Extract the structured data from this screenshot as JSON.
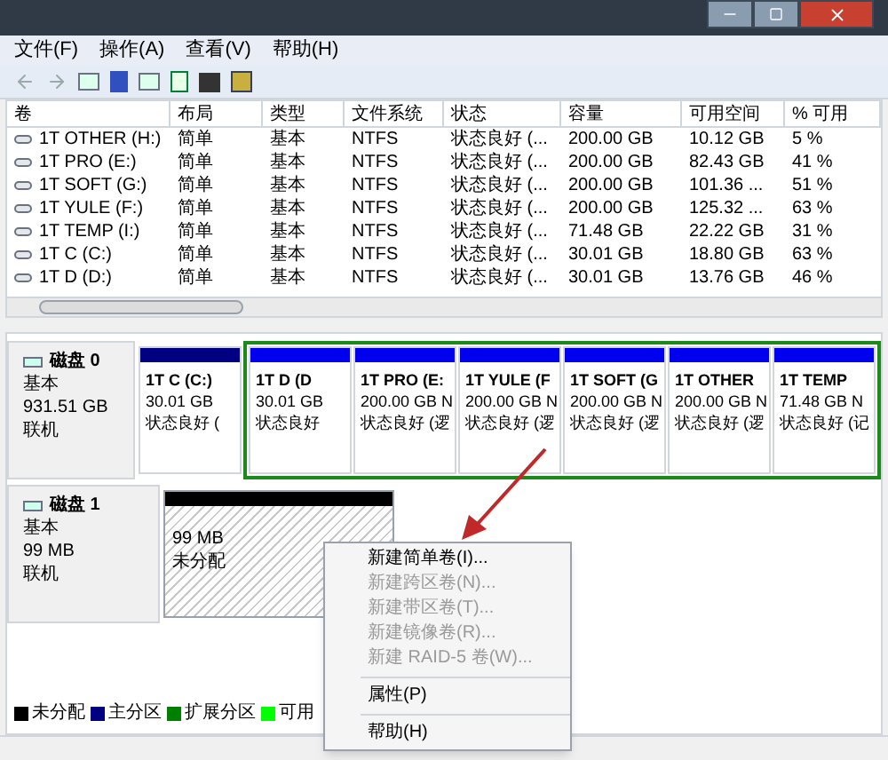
{
  "menu_bar": [
    "文件(F)",
    "操作(A)",
    "查看(V)",
    "帮助(H)"
  ],
  "table": {
    "columns": [
      "卷",
      "布局",
      "类型",
      "文件系统",
      "状态",
      "容量",
      "可用空间",
      "% 可用"
    ],
    "rows": [
      {
        "cells": [
          "1T OTHER (H:)",
          "简单",
          "基本",
          "NTFS",
          "状态良好 (...",
          "200.00 GB",
          "10.12 GB",
          "5 %"
        ]
      },
      {
        "cells": [
          "1T PRO (E:)",
          "简单",
          "基本",
          "NTFS",
          "状态良好 (...",
          "200.00 GB",
          "82.43 GB",
          "41 %"
        ]
      },
      {
        "cells": [
          "1T SOFT (G:)",
          "简单",
          "基本",
          "NTFS",
          "状态良好 (...",
          "200.00 GB",
          "101.36 ...",
          "51 %"
        ]
      },
      {
        "cells": [
          "1T YULE (F:)",
          "简单",
          "基本",
          "NTFS",
          "状态良好 (...",
          "200.00 GB",
          "125.32 ...",
          "63 %"
        ]
      },
      {
        "cells": [
          "1T TEMP (I:)",
          "简单",
          "基本",
          "NTFS",
          "状态良好 (...",
          "71.48 GB",
          "22.22 GB",
          "31 %"
        ]
      },
      {
        "cells": [
          "1T C (C:)",
          "简单",
          "基本",
          "NTFS",
          "状态良好 (...",
          "30.01 GB",
          "18.80 GB",
          "63 %"
        ]
      },
      {
        "cells": [
          "1T D (D:)",
          "简单",
          "基本",
          "NTFS",
          "状态良好 (...",
          "30.01 GB",
          "13.76 GB",
          "46 %"
        ]
      }
    ]
  },
  "disks": [
    {
      "name": "磁盘 0",
      "type": "基本",
      "size": "931.51 GB",
      "status": "联机",
      "partitions": [
        {
          "kind": "primary",
          "selected": false,
          "name": "1T C  (C:)",
          "size": "30.01 GB",
          "status": "状态良好 ("
        },
        {
          "kind": "logical",
          "selected": true,
          "name": "1T D  (D",
          "size": "30.01 GB",
          "status": "状态良好"
        },
        {
          "kind": "logical",
          "selected": true,
          "name": "1T PRO  (E:",
          "size": "200.00 GB N",
          "status": "状态良好 (逻"
        },
        {
          "kind": "logical",
          "selected": true,
          "name": "1T YULE  (F",
          "size": "200.00 GB N",
          "status": "状态良好 (逻"
        },
        {
          "kind": "logical",
          "selected": true,
          "name": "1T SOFT  (G",
          "size": "200.00 GB N",
          "status": "状态良好 (逻"
        },
        {
          "kind": "logical",
          "selected": true,
          "name": "1T OTHER",
          "size": "200.00 GB N",
          "status": "状态良好 (逻"
        },
        {
          "kind": "logical",
          "selected": true,
          "name": "1T TEMP",
          "size": "71.48 GB N",
          "status": "状态良好 (记"
        }
      ]
    },
    {
      "name": "磁盘 1",
      "type": "基本",
      "size": "99 MB",
      "status": "联机",
      "partitions": [
        {
          "kind": "unallocated",
          "selected": false,
          "size": "99 MB",
          "status": "未分配"
        }
      ]
    }
  ],
  "legend": [
    {
      "label": "未分配",
      "color": "#000000"
    },
    {
      "label": "主分区",
      "color": "#000080"
    },
    {
      "label": "扩展分区",
      "color": "#008000"
    },
    {
      "label": "可用",
      "color": "#00ff00"
    }
  ],
  "context_menu": [
    {
      "kind": "item",
      "label": "新建简单卷(I)...",
      "disabled": false
    },
    {
      "kind": "item",
      "label": "新建跨区卷(N)...",
      "disabled": true
    },
    {
      "kind": "item",
      "label": "新建带区卷(T)...",
      "disabled": true
    },
    {
      "kind": "item",
      "label": "新建镜像卷(R)...",
      "disabled": true
    },
    {
      "kind": "item",
      "label": "新建 RAID-5 卷(W)...",
      "disabled": true
    },
    {
      "kind": "separator"
    },
    {
      "kind": "item",
      "label": "属性(P)",
      "disabled": false
    },
    {
      "kind": "separator"
    },
    {
      "kind": "item",
      "label": "帮助(H)",
      "disabled": false
    }
  ]
}
